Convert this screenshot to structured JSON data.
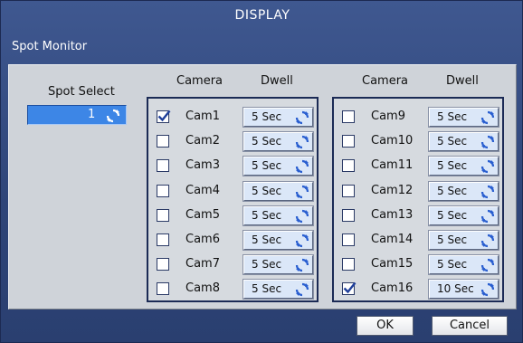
{
  "window": {
    "title": "DISPLAY",
    "subtitle": "Spot Monitor"
  },
  "spot": {
    "label": "Spot Select",
    "value": "1"
  },
  "headers": {
    "camera": "Camera",
    "dwell": "Dwell"
  },
  "cameras_left": [
    {
      "name": "Cam1",
      "checked": true,
      "dwell": "5 Sec"
    },
    {
      "name": "Cam2",
      "checked": false,
      "dwell": "5 Sec"
    },
    {
      "name": "Cam3",
      "checked": false,
      "dwell": "5 Sec"
    },
    {
      "name": "Cam4",
      "checked": false,
      "dwell": "5 Sec"
    },
    {
      "name": "Cam5",
      "checked": false,
      "dwell": "5 Sec"
    },
    {
      "name": "Cam6",
      "checked": false,
      "dwell": "5 Sec"
    },
    {
      "name": "Cam7",
      "checked": false,
      "dwell": "5 Sec"
    },
    {
      "name": "Cam8",
      "checked": false,
      "dwell": "5 Sec"
    }
  ],
  "cameras_right": [
    {
      "name": "Cam9",
      "checked": false,
      "dwell": "5 Sec"
    },
    {
      "name": "Cam10",
      "checked": false,
      "dwell": "5 Sec"
    },
    {
      "name": "Cam11",
      "checked": false,
      "dwell": "5 Sec"
    },
    {
      "name": "Cam12",
      "checked": false,
      "dwell": "5 Sec"
    },
    {
      "name": "Cam13",
      "checked": false,
      "dwell": "5 Sec"
    },
    {
      "name": "Cam14",
      "checked": false,
      "dwell": "5 Sec"
    },
    {
      "name": "Cam15",
      "checked": false,
      "dwell": "5 Sec"
    },
    {
      "name": "Cam16",
      "checked": true,
      "dwell": "10 Sec"
    }
  ],
  "buttons": {
    "ok": "OK",
    "cancel": "Cancel"
  },
  "colors": {
    "background": "#2e4478",
    "panel": "#cfd3d9",
    "selection": "#3d86e6",
    "spinner": "#2a5fd0"
  },
  "icons": {
    "spinner": "refresh-cycle-icon",
    "check": "checkmark-icon"
  }
}
